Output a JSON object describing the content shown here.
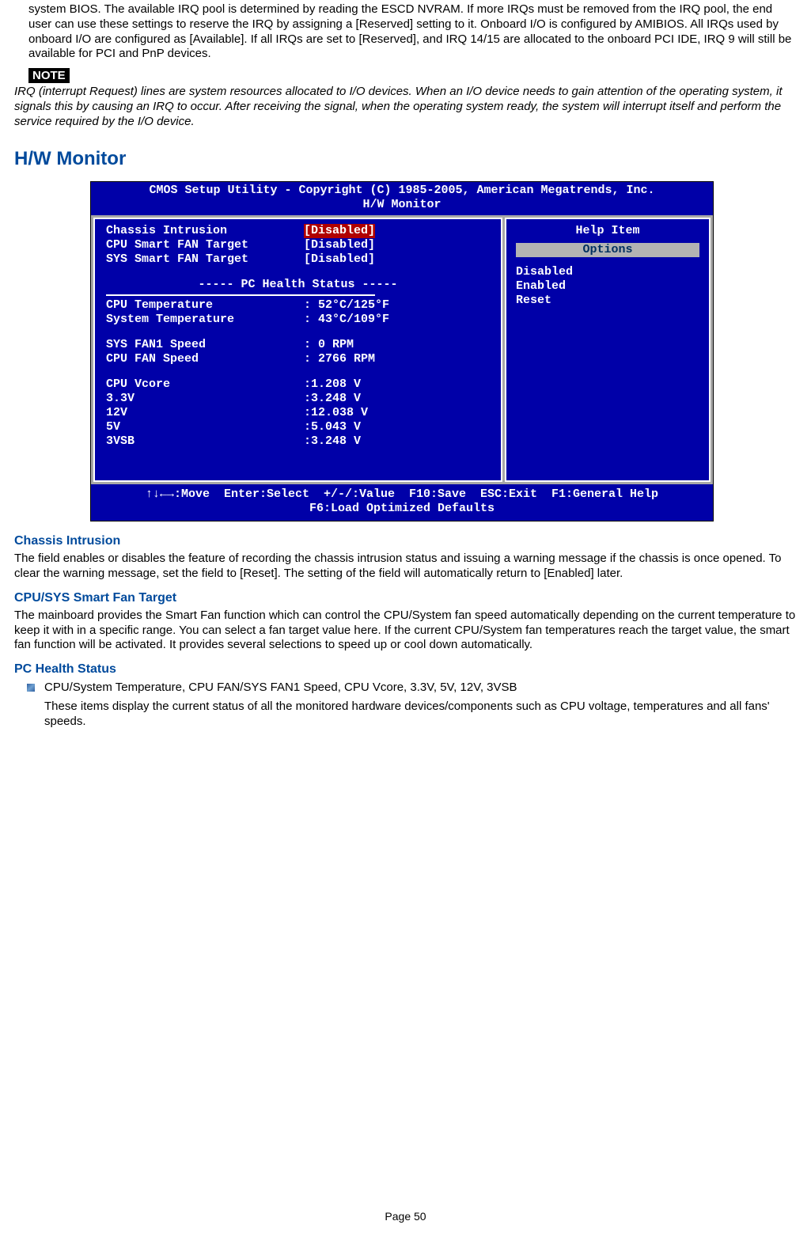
{
  "intro_para": "system BIOS. The available IRQ pool is determined by reading the ESCD NVRAM. If more IRQs must be removed from the IRQ pool, the end user can use these settings to reserve the IRQ by assigning a [Reserved] setting to it. Onboard I/O is configured by AMIBIOS. All IRQs used by onboard I/O are configured as [Available]. If all IRQs are set to [Reserved], and IRQ 14/15 are allocated to the onboard PCI IDE, IRQ 9 will still be available for PCI and PnP devices.",
  "note_tag": "NOTE",
  "note_body": "IRQ (interrupt Request) lines are system resources allocated to I/O devices. When an I/O device needs to gain attention of the operating system, it signals this by causing an IRQ to occur. After receiving the signal, when the operating system ready, the system will interrupt itself and perform the service required by the I/O device.",
  "section_heading": "H/W Monitor",
  "bios": {
    "title1": "CMOS Setup Utility - Copyright (C) 1985-2005, American Megatrends, Inc.",
    "title2": "H/W Monitor",
    "fields": {
      "f0": {
        "label": "Chassis Intrusion",
        "val": "[Disabled]"
      },
      "f1": {
        "label": "CPU Smart FAN Target",
        "val": "[Disabled]"
      },
      "f2": {
        "label": "SYS Smart FAN Target",
        "val": "[Disabled]"
      }
    },
    "pc_health_title": "----- PC Health Status -----",
    "health": {
      "h0": {
        "label": "CPU Temperature",
        "val": ": 52°C/125°F"
      },
      "h1": {
        "label": "System Temperature",
        "val": ": 43°C/109°F"
      },
      "h2": {
        "label": "SYS FAN1 Speed",
        "val": ": 0 RPM"
      },
      "h3": {
        "label": "CPU FAN Speed",
        "val": ": 2766 RPM"
      },
      "h4": {
        "label": "CPU Vcore",
        "val": ":1.208 V"
      },
      "h5": {
        "label": "3.3V",
        "val": ":3.248 V"
      },
      "h6": {
        "label": "12V",
        "val": ":12.038 V"
      },
      "h7": {
        "label": "5V",
        "val": ":5.043 V"
      },
      "h8": {
        "label": "3VSB",
        "val": ":3.248 V"
      }
    },
    "help_head": "Help Item",
    "options_label": "Options",
    "options": {
      "o0": "Disabled",
      "o1": "Enabled",
      "o2": "Reset"
    },
    "foot1": "↑↓←→:Move  Enter:Select  +/-/:Value  F10:Save  ESC:Exit  F1:General Help",
    "foot2": "F6:Load Optimized Defaults"
  },
  "chassis": {
    "h": "Chassis Intrusion",
    "p": "The field enables or disables the feature of recording the chassis intrusion status and issuing a warning message if the chassis is once opened. To clear the warning message, set the field to [Reset]. The setting of the field will automatically return to [Enabled] later."
  },
  "smartfan": {
    "h": "CPU/SYS Smart Fan Target",
    "p": "The mainboard provides the Smart Fan function which can control the CPU/System fan speed automatically depending on the current temperature to keep it with in a specific range. You can select a fan target value here. If the current CPU/System fan temperatures reach the target value, the smart fan function will be activated. It provides several selections to speed up or cool down automatically."
  },
  "pchealth": {
    "h": "PC Health Status",
    "b1": "CPU/System Temperature, CPU FAN/SYS FAN1 Speed, CPU Vcore, 3.3V, 5V, 12V, 3VSB",
    "b2": "These items display the current status of all the monitored hardware devices/components such as CPU voltage, temperatures and all fans' speeds."
  },
  "page_num": "Page 50"
}
